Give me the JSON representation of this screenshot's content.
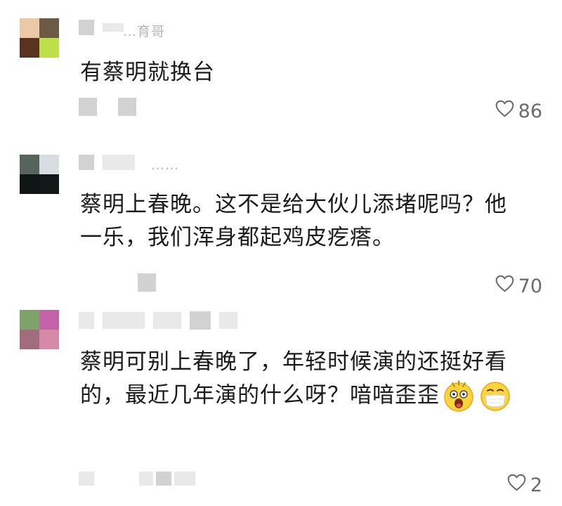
{
  "comments": [
    {
      "name_visible": "…育哥",
      "text": "有蔡明就换台",
      "likes": "86",
      "avatar_colors": [
        "#ecc9a6",
        "#6d5a45",
        "#5a3220",
        "#bde04a"
      ]
    },
    {
      "name_visible": "……",
      "text": "蔡明上春晚。这不是给大伙儿添堵呢吗？他一乐，我们浑身都起鸡皮疙瘩。",
      "likes": "70",
      "avatar_colors": [
        "#55655c",
        "#d8dde2",
        "#101515",
        "#131819"
      ]
    },
    {
      "name_visible": "",
      "text": "蔡明可别上春晚了，年轻时候演的还挺好看的，最近几年演的什么呀？喑喑歪歪",
      "likes": "2",
      "emojis": [
        "shocked-emoji",
        "masked-emoji"
      ],
      "avatar_colors": [
        "#7fa16a",
        "#c462a9",
        "#a36c7c",
        "#d68aa8"
      ]
    }
  ],
  "icons": {
    "like": "heart-outline-icon"
  },
  "colors": {
    "like_text": "#6b6b6b",
    "body_text": "#1b1b1b",
    "placeholder_block": "#d2d2d2"
  }
}
